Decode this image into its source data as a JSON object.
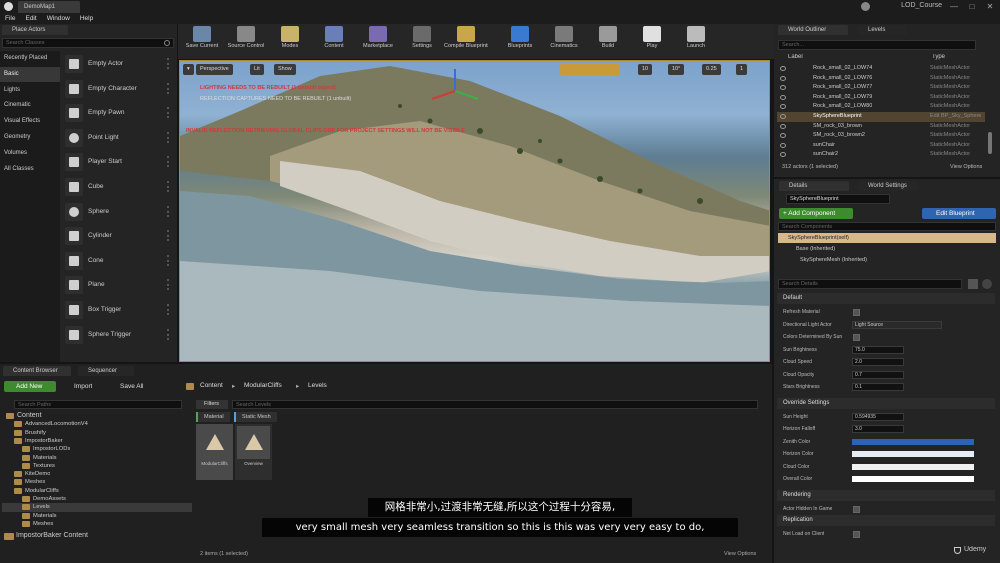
{
  "window": {
    "doc_tab": "DemoMap1",
    "project_name": "LOD_Course",
    "minimize": "—",
    "maximize": "□",
    "close": "✕"
  },
  "menu": [
    "File",
    "Edit",
    "Window",
    "Help"
  ],
  "place_actors": {
    "tab": "Place Actors",
    "search_placeholder": "Search Classes",
    "categories": [
      "Recently Placed",
      "Basic",
      "Lights",
      "Cinematic",
      "Visual Effects",
      "Geometry",
      "Volumes",
      "All Classes"
    ],
    "selected_category": "Basic",
    "items": [
      "Empty Actor",
      "Empty Character",
      "Empty Pawn",
      "Point Light",
      "Player Start",
      "Cube",
      "Sphere",
      "Cylinder",
      "Cone",
      "Plane",
      "Box Trigger",
      "Sphere Trigger"
    ]
  },
  "toolbar": {
    "buttons": [
      {
        "label": "Save Current",
        "icon": "save-icon"
      },
      {
        "label": "Source Control",
        "icon": "source-control-icon"
      },
      {
        "label": "Modes",
        "icon": "modes-icon"
      },
      {
        "label": "Content",
        "icon": "content-icon"
      },
      {
        "label": "Marketplace",
        "icon": "marketplace-icon"
      },
      {
        "label": "Settings",
        "icon": "settings-icon"
      },
      {
        "label": "Compile Blueprints",
        "icon": "compile-icon"
      },
      {
        "label": "Blueprints",
        "icon": "blueprints-icon"
      },
      {
        "label": "Cinematics",
        "icon": "cinematics-icon"
      },
      {
        "label": "Build",
        "icon": "build-icon"
      },
      {
        "label": "Play",
        "icon": "play-icon"
      },
      {
        "label": "Launch",
        "icon": "launch-icon"
      }
    ]
  },
  "viewport": {
    "perspective": "Perspective",
    "lit": "Lit",
    "show": "Show",
    "grid_snap": "10",
    "rot_snap": "10°",
    "scale_snap": "0.25",
    "camera_speed": "1",
    "warnings": [
      "LIGHTING NEEDS TO BE REBUILT (1 unbuilt object)",
      "REFLECTION CAPTURES NEED TO BE REBUILT (1 unbuilt)",
      "INVALID REFLECTION RETRIEVING GLOBAL CLIPS ONE FOR PROJECT SETTINGS WILL NOT BE VISIBLE"
    ]
  },
  "world_outliner": {
    "tab": "World Outliner",
    "levels_tab": "Levels",
    "search_placeholder": "Search...",
    "col_label": "Label",
    "col_type": "Type",
    "rows": [
      {
        "label": "Rock_small_02_LOW74",
        "type": "StaticMeshActor"
      },
      {
        "label": "Rock_small_02_LOW76",
        "type": "StaticMeshActor"
      },
      {
        "label": "Rock_small_02_LOW77",
        "type": "StaticMeshActor"
      },
      {
        "label": "Rock_small_02_LOW79",
        "type": "StaticMeshActor"
      },
      {
        "label": "Rock_small_02_LOW80",
        "type": "StaticMeshActor"
      },
      {
        "label": "SkySphereBlueprint",
        "type": "Edit BP_Sky_Sphere"
      },
      {
        "label": "SM_rock_03_brown",
        "type": "StaticMeshActor"
      },
      {
        "label": "SM_rock_03_brown2",
        "type": "StaticMeshActor"
      },
      {
        "label": "sunChair",
        "type": "StaticMeshActor"
      },
      {
        "label": "sunChair2",
        "type": "StaticMeshActor"
      }
    ],
    "selected_row": "SkySphereBlueprint",
    "status": "312 actors (1 selected)",
    "view_options": "View Options"
  },
  "details": {
    "tab": "Details",
    "world_settings_tab": "World Settings",
    "actor_name": "SkySphereBlueprint",
    "add_component": "+ Add Component",
    "edit_blueprint": "Edit Blueprint",
    "search_components": "Search Components",
    "root_component": "SkySphereBlueprint(self)",
    "components": [
      "Base (Inherited)",
      "SkySphereMesh (Inherited)"
    ],
    "search_details": "Search Details",
    "sections": {
      "default": "Default",
      "override": "Override Settings",
      "rendering": "Rendering",
      "replication": "Replication"
    },
    "default_props": [
      {
        "label": "Refresh Material",
        "kind": "check"
      },
      {
        "label": "Directional Light Actor",
        "kind": "select",
        "value": "Light Source"
      },
      {
        "label": "Colors Determined By Sun",
        "kind": "check"
      },
      {
        "label": "Sun Brightness",
        "kind": "num",
        "value": "75.0"
      },
      {
        "label": "Cloud Speed",
        "kind": "num",
        "value": "2.0"
      },
      {
        "label": "Cloud Opacity",
        "kind": "num",
        "value": "0.7"
      },
      {
        "label": "Stars Brightness",
        "kind": "num",
        "value": "0.1"
      }
    ],
    "override_props": [
      {
        "label": "Sun Height",
        "kind": "num",
        "value": "0.594935"
      },
      {
        "label": "Horizon Falloff",
        "kind": "num",
        "value": "3.0"
      },
      {
        "label": "Zenith Color",
        "kind": "color",
        "color": "#2d62b8"
      },
      {
        "label": "Horizon Color",
        "kind": "color",
        "color": "#e6ecf4"
      },
      {
        "label": "Cloud Color",
        "kind": "color",
        "color": "#f0f0f0"
      },
      {
        "label": "Overall Color",
        "kind": "color",
        "color": "#ffffff"
      }
    ],
    "rendering_props": [
      {
        "label": "Actor Hidden In Game",
        "kind": "check"
      }
    ],
    "replication_props": [
      {
        "label": "Net Load on Client",
        "kind": "check"
      }
    ]
  },
  "content_browser": {
    "tab": "Content Browser",
    "sequencer_tab": "Sequencer",
    "add_new": "Add New",
    "import": "Import",
    "save_all": "Save All",
    "breadcrumb": [
      "Content",
      "ModularCliffs",
      "Levels"
    ],
    "search_paths": "Search Paths",
    "filters": "Filters",
    "search_assets": "Search Levels",
    "type_filters": [
      "Material",
      "Static Mesh"
    ],
    "tree": [
      {
        "label": "Content",
        "depth": 0
      },
      {
        "label": "AdvancedLocomotionV4",
        "depth": 1
      },
      {
        "label": "Brushify",
        "depth": 1
      },
      {
        "label": "ImpostorBaker",
        "depth": 1
      },
      {
        "label": "ImpostorLODs",
        "depth": 2
      },
      {
        "label": "Materials",
        "depth": 2
      },
      {
        "label": "Textures",
        "depth": 2
      },
      {
        "label": "KiteDemo",
        "depth": 1
      },
      {
        "label": "Meshes",
        "depth": 1
      },
      {
        "label": "ModularCliffs",
        "depth": 1
      },
      {
        "label": "DemoAssets",
        "depth": 2
      },
      {
        "label": "Levels",
        "depth": 2
      },
      {
        "label": "Materials",
        "depth": 2
      },
      {
        "label": "Meshes",
        "depth": 2
      }
    ],
    "selected_folder": "Levels",
    "impostor_content": "ImpostorBaker Content",
    "assets": [
      {
        "label": "ModularCliffs"
      },
      {
        "label": "Overview"
      }
    ],
    "status": "2 items (1 selected)",
    "view_options": "View Options"
  },
  "subtitles": {
    "zh": "网格非常小,过渡非常无缝,所以这个过程十分容易,",
    "en": "very small mesh very seamless transition so this is this was very very easy to do,"
  },
  "watermark": "Udemy"
}
